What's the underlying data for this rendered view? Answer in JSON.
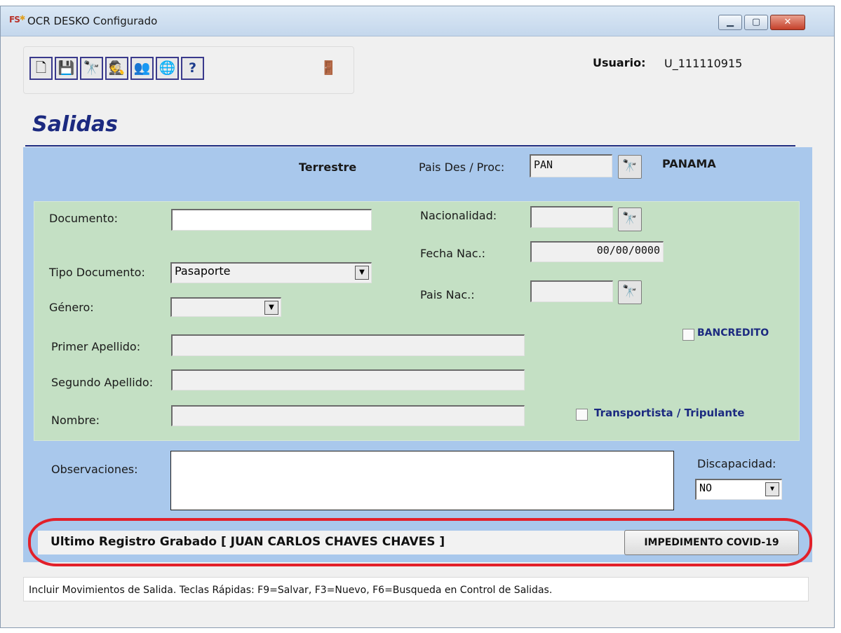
{
  "window": {
    "title": "OCR DESKO Configurado",
    "app_icon": "FS",
    "minimize_glyph": "▁",
    "maximize_glyph": "▢",
    "close_glyph": "✕"
  },
  "toolbar": {
    "buttons": [
      {
        "name": "new-icon",
        "glyph": "🗋"
      },
      {
        "name": "save-icon",
        "glyph": "💾"
      },
      {
        "name": "binoculars-icon",
        "glyph": "🔭"
      },
      {
        "name": "spy-icon",
        "glyph": "🕵"
      },
      {
        "name": "users-icon",
        "glyph": "👥"
      },
      {
        "name": "globe-icon",
        "glyph": "🌐"
      },
      {
        "name": "help-icon",
        "glyph": "?"
      },
      {
        "name": "exit-door-icon",
        "glyph": "🚪"
      }
    ]
  },
  "user": {
    "label": "Usuario:",
    "value": "U_111110915"
  },
  "page": {
    "title": "Salidas"
  },
  "top_section": {
    "mode": "Terrestre",
    "pais_label": "Pais Des / Proc:",
    "pais_code": "PAN",
    "pais_name": "PANAMA"
  },
  "form": {
    "documento_label": "Documento:",
    "documento_value": "",
    "tipo_documento_label": "Tipo Documento:",
    "tipo_documento_value": "Pasaporte",
    "genero_label": "Género:",
    "genero_value": "",
    "primer_apellido_label": "Primer Apellido:",
    "primer_apellido_value": "",
    "segundo_apellido_label": "Segundo Apellido:",
    "segundo_apellido_value": "",
    "nombre_label": "Nombre:",
    "nombre_value": "",
    "nacionalidad_label": "Nacionalidad:",
    "nacionalidad_value": "",
    "fecha_nac_label": "Fecha Nac.:",
    "fecha_nac_value": "00/00/0000",
    "pais_nac_label": "Pais Nac.:",
    "pais_nac_value": "",
    "bancredito_label": "BANCREDITO",
    "bancredito_checked": false,
    "transportista_label": "Transportista / Tripulante",
    "transportista_checked": false
  },
  "observaciones": {
    "label": "Observaciones:",
    "value": ""
  },
  "discapacidad": {
    "label": "Discapacidad:",
    "value": "NO"
  },
  "last_record": {
    "text": "Ultimo Registro Grabado  [ JUAN CARLOS CHAVES CHAVES ]",
    "button_label": "IMPEDIMENTO COVID-19"
  },
  "status": {
    "text": "Incluir Movimientos de Salida. Teclas Rápidas: F9=Salvar, F3=Nuevo, F6=Busqueda en Control de Salidas."
  },
  "colors": {
    "panel_blue": "#a9c8ec",
    "panel_green": "#c4e0c4",
    "title_navy": "#1c2a80",
    "highlight_red": "#e2202a"
  }
}
